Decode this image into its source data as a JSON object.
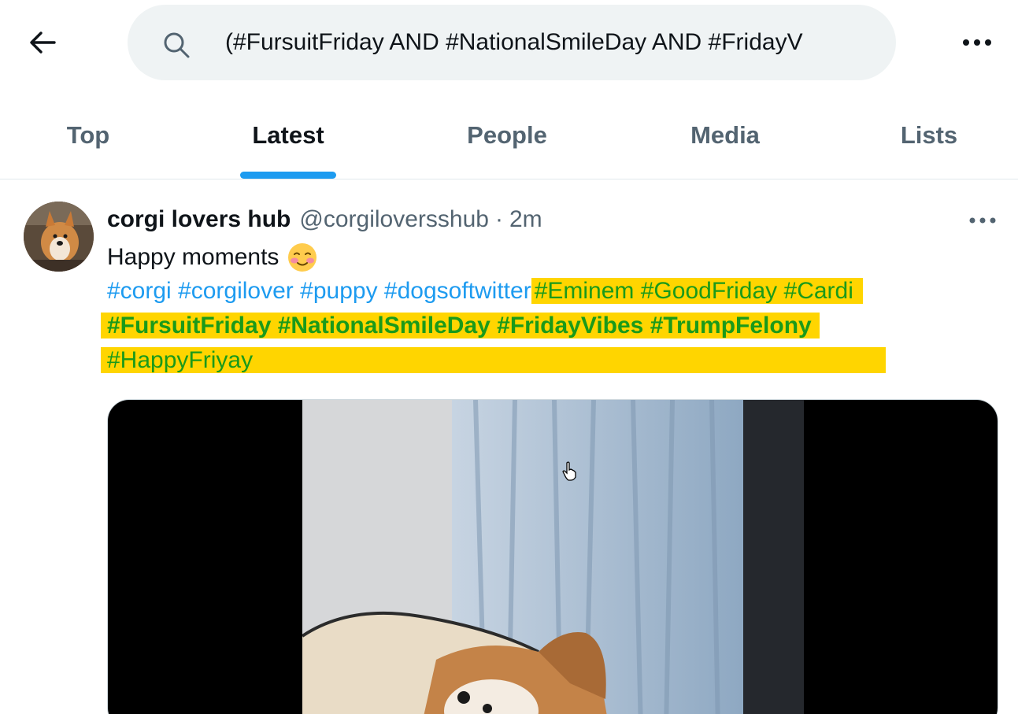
{
  "search": {
    "query": "(#FursuitFriday AND #NationalSmileDay AND #FridayV"
  },
  "tabs": [
    {
      "label": "Top"
    },
    {
      "label": "Latest"
    },
    {
      "label": "People"
    },
    {
      "label": "Media"
    },
    {
      "label": "Lists"
    }
  ],
  "active_tab": "Latest",
  "post": {
    "author": "corgi lovers hub",
    "handle": "@corgiloversshub",
    "separator": "·",
    "time": "2m",
    "text": "Happy moments",
    "emoji": "smiling-face-with-blush-emoji",
    "hashtags_line1_blue": [
      "#corgi",
      "#corgilover",
      "#puppy",
      "#dogsoftwitter"
    ],
    "hashtags_line1_highlight": "#Eminem #GoodFriday #Cardi",
    "hashtags_line2_highlight": "#FursuitFriday #NationalSmileDay #FridayVibes #TrumpFelony",
    "hashtags_line3_highlight": "#HappyFriyay"
  },
  "colors": {
    "accent": "#1d9bf0",
    "highlight_bg": "#ffd500",
    "highlight_text": "#1a9a1a",
    "secondary_text": "#536471"
  }
}
